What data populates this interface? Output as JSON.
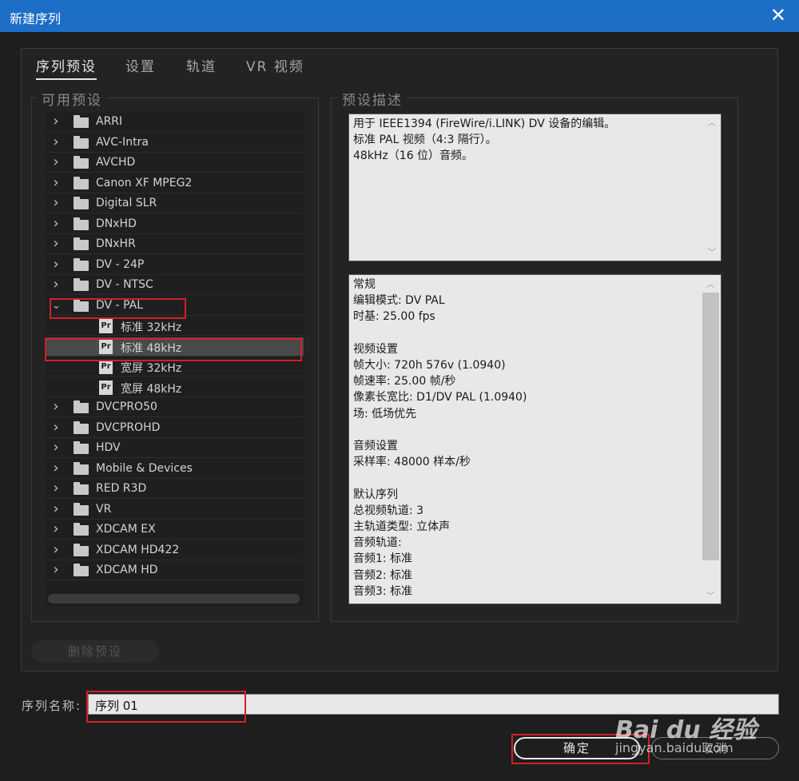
{
  "window": {
    "title": "新建序列",
    "close_glyph": "✕"
  },
  "tabs": [
    {
      "label": "序列预设",
      "active": true
    },
    {
      "label": "设置",
      "active": false
    },
    {
      "label": "轨道",
      "active": false
    },
    {
      "label": "VR 视频",
      "active": false
    }
  ],
  "available_presets": {
    "label": "可用预设",
    "items": [
      {
        "label": "ARRI",
        "type": "folder",
        "expanded": false
      },
      {
        "label": "AVC-Intra",
        "type": "folder",
        "expanded": false
      },
      {
        "label": "AVCHD",
        "type": "folder",
        "expanded": false
      },
      {
        "label": "Canon XF MPEG2",
        "type": "folder",
        "expanded": false
      },
      {
        "label": "Digital SLR",
        "type": "folder",
        "expanded": false
      },
      {
        "label": "DNxHD",
        "type": "folder",
        "expanded": false
      },
      {
        "label": "DNxHR",
        "type": "folder",
        "expanded": false
      },
      {
        "label": "DV - 24P",
        "type": "folder",
        "expanded": false
      },
      {
        "label": "DV - NTSC",
        "type": "folder",
        "expanded": false
      },
      {
        "label": "DV - PAL",
        "type": "folder",
        "expanded": true
      },
      {
        "label": "标准 32kHz",
        "type": "preset"
      },
      {
        "label": "标准 48kHz",
        "type": "preset",
        "selected": true
      },
      {
        "label": "宽屏 32kHz",
        "type": "preset"
      },
      {
        "label": "宽屏 48kHz",
        "type": "preset"
      },
      {
        "label": "DVCPRO50",
        "type": "folder",
        "expanded": false
      },
      {
        "label": "DVCPROHD",
        "type": "folder",
        "expanded": false
      },
      {
        "label": "HDV",
        "type": "folder",
        "expanded": false
      },
      {
        "label": "Mobile & Devices",
        "type": "folder",
        "expanded": false
      },
      {
        "label": "RED R3D",
        "type": "folder",
        "expanded": false
      },
      {
        "label": "VR",
        "type": "folder",
        "expanded": false
      },
      {
        "label": "XDCAM EX",
        "type": "folder",
        "expanded": false
      },
      {
        "label": "XDCAM HD422",
        "type": "folder",
        "expanded": false
      },
      {
        "label": "XDCAM HD",
        "type": "folder",
        "expanded": false
      }
    ],
    "icons": {
      "folder": "folder-icon",
      "preset": "premiere-preset-icon",
      "collapsed": "chevron-right-icon",
      "expanded": "chevron-down-icon"
    },
    "pr_icon_text": "Pr"
  },
  "preset_description": {
    "label": "预设描述",
    "description_lines": [
      "用于 IEEE1394 (FireWire/i.LINK) DV 设备的编辑。",
      "标准 PAL 视频（4:3 隔行）。",
      "48kHz（16 位）音频。"
    ],
    "details_lines": [
      "常规",
      " 编辑模式: DV PAL",
      " 时基: 25.00 fps",
      "",
      "视频设置",
      " 帧大小: 720h 576v (1.0940)",
      " 帧速率: 25.00  帧/秒",
      " 像素长宽比: D1/DV PAL (1.0940)",
      " 场: 低场优先",
      "",
      "音频设置",
      " 采样率: 48000 样本/秒",
      "",
      "默认序列",
      " 总视频轨道: 3",
      " 主轨道类型: 立体声",
      " 音频轨道:",
      " 音频1: 标准",
      " 音频2: 标准",
      " 音频3: 标准"
    ],
    "scroll_up_glyph": "︿",
    "scroll_down_glyph": "﹀"
  },
  "delete_preset_button": "删除预设",
  "sequence_name": {
    "label": "序列名称:",
    "value": "序列 01"
  },
  "buttons": {
    "ok": "确定",
    "cancel": "取消"
  },
  "watermark": {
    "logo": "Bai du 经验",
    "url": "jingyan.baidu.com"
  },
  "colors": {
    "titlebar": "#1d6ec7",
    "highlight": "#d0202a",
    "selected_row": "#4a4a4a"
  }
}
